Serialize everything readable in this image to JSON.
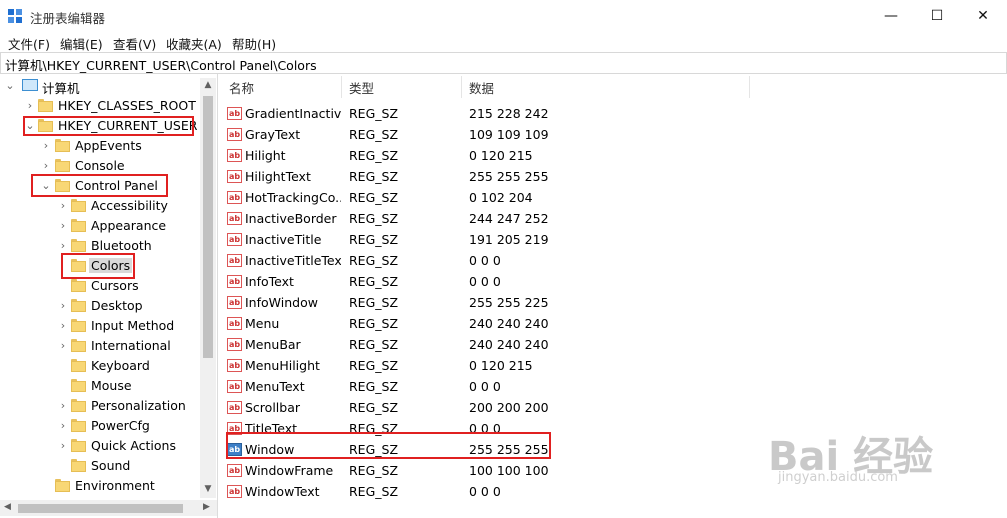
{
  "window": {
    "title": "注册表编辑器",
    "minimize": "—",
    "maximize": "☐",
    "close": "✕"
  },
  "menu": [
    "文件(F)",
    "编辑(E)",
    "查看(V)",
    "收藏夹(A)",
    "帮助(H)"
  ],
  "address": "计算机\\HKEY_CURRENT_USER\\Control Panel\\Colors",
  "tree": {
    "root": "计算机",
    "items": [
      {
        "label": "HKEY_CLASSES_ROOT"
      },
      {
        "label": "HKEY_CURRENT_USER"
      },
      {
        "label": "AppEvents"
      },
      {
        "label": "Console"
      },
      {
        "label": "Control Panel"
      },
      {
        "label": "Accessibility"
      },
      {
        "label": "Appearance"
      },
      {
        "label": "Bluetooth"
      },
      {
        "label": "Colors"
      },
      {
        "label": "Cursors"
      },
      {
        "label": "Desktop"
      },
      {
        "label": "Input Method"
      },
      {
        "label": "International"
      },
      {
        "label": "Keyboard"
      },
      {
        "label": "Mouse"
      },
      {
        "label": "Personalization"
      },
      {
        "label": "PowerCfg"
      },
      {
        "label": "Quick Actions"
      },
      {
        "label": "Sound"
      },
      {
        "label": "Environment"
      }
    ]
  },
  "columns": {
    "name": "名称",
    "type": "类型",
    "data": "数据"
  },
  "values": [
    {
      "name": "GradientInactiv...",
      "type": "REG_SZ",
      "data": "215 228 242"
    },
    {
      "name": "GrayText",
      "type": "REG_SZ",
      "data": "109 109 109"
    },
    {
      "name": "Hilight",
      "type": "REG_SZ",
      "data": "0 120 215"
    },
    {
      "name": "HilightText",
      "type": "REG_SZ",
      "data": "255 255 255"
    },
    {
      "name": "HotTrackingCo...",
      "type": "REG_SZ",
      "data": "0 102 204"
    },
    {
      "name": "InactiveBorder",
      "type": "REG_SZ",
      "data": "244 247 252"
    },
    {
      "name": "InactiveTitle",
      "type": "REG_SZ",
      "data": "191 205 219"
    },
    {
      "name": "InactiveTitleText",
      "type": "REG_SZ",
      "data": "0 0 0"
    },
    {
      "name": "InfoText",
      "type": "REG_SZ",
      "data": "0 0 0"
    },
    {
      "name": "InfoWindow",
      "type": "REG_SZ",
      "data": "255 255 225"
    },
    {
      "name": "Menu",
      "type": "REG_SZ",
      "data": "240 240 240"
    },
    {
      "name": "MenuBar",
      "type": "REG_SZ",
      "data": "240 240 240"
    },
    {
      "name": "MenuHilight",
      "type": "REG_SZ",
      "data": "0 120 215"
    },
    {
      "name": "MenuText",
      "type": "REG_SZ",
      "data": "0 0 0"
    },
    {
      "name": "Scrollbar",
      "type": "REG_SZ",
      "data": "200 200 200"
    },
    {
      "name": "TitleText",
      "type": "REG_SZ",
      "data": "0 0 0"
    },
    {
      "name": "Window",
      "type": "REG_SZ",
      "data": "255 255 255"
    },
    {
      "name": "WindowFrame",
      "type": "REG_SZ",
      "data": "100 100 100"
    },
    {
      "name": "WindowText",
      "type": "REG_SZ",
      "data": "0 0 0"
    }
  ],
  "value_icon": "ab",
  "watermark": {
    "brand": "Bai 经验",
    "url": "jingyan.baidu.com"
  },
  "colors": {
    "highlight": "#e02020"
  }
}
